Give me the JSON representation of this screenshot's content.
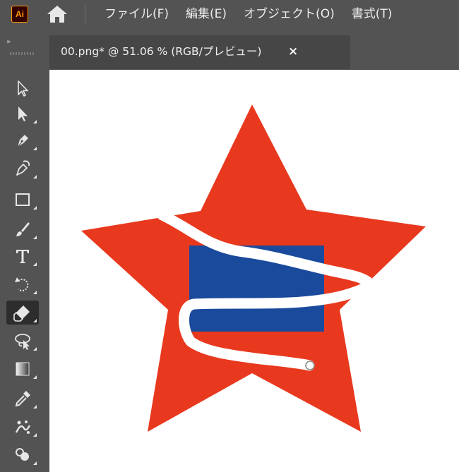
{
  "app": {
    "logo": "Ai",
    "brand_color": "#ff9a00"
  },
  "menu": [
    {
      "label": "ファイル(F)"
    },
    {
      "label": "編集(E)"
    },
    {
      "label": "オブジェクト(O)"
    },
    {
      "label": "書式(T)"
    }
  ],
  "document_tab": {
    "title": "00.png* @ 51.06 % (RGB/プレビュー)",
    "close": "×"
  },
  "toolbar": {
    "collapse": "»",
    "tools": [
      {
        "name": "selection-tool-icon",
        "active": false
      },
      {
        "name": "direct-selection-tool-icon",
        "active": false
      },
      {
        "name": "pen-tool-icon",
        "active": false
      },
      {
        "name": "curvature-tool-icon",
        "active": false
      },
      {
        "name": "rectangle-tool-icon",
        "active": false
      },
      {
        "name": "paintbrush-tool-icon",
        "active": false
      },
      {
        "name": "type-tool-icon",
        "active": false
      },
      {
        "name": "rotate-tool-icon",
        "active": false
      },
      {
        "name": "eraser-tool-icon",
        "active": true
      },
      {
        "name": "lasso-tool-icon",
        "active": false
      },
      {
        "name": "gradient-tool-icon",
        "active": false
      },
      {
        "name": "eyedropper-tool-icon",
        "active": false
      },
      {
        "name": "symbol-sprayer-tool-icon",
        "active": false
      },
      {
        "name": "shape-builder-tool-icon",
        "active": false
      }
    ]
  },
  "artwork": {
    "star_color": "#e8391f",
    "rect_color": "#1a4a9c",
    "eraser_stroke_color": "#ffffff"
  }
}
